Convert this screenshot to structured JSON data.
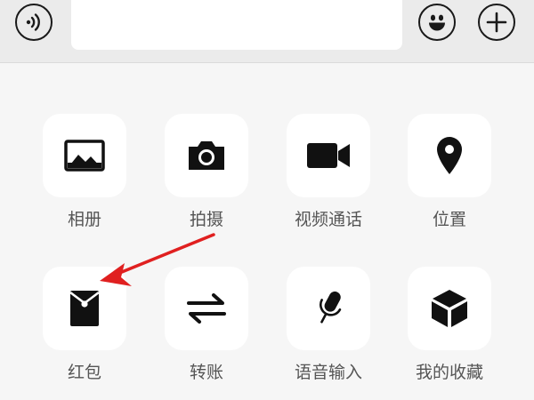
{
  "composer": {
    "voice_icon": "voice-wave-icon",
    "input_value": "",
    "emoji_icon": "smiley-icon",
    "more_icon": "plus-icon"
  },
  "panel": {
    "items": [
      {
        "label": "相册",
        "icon": "image-icon"
      },
      {
        "label": "拍摄",
        "icon": "camera-icon"
      },
      {
        "label": "视频通话",
        "icon": "video-camera-icon"
      },
      {
        "label": "位置",
        "icon": "location-pin-icon"
      },
      {
        "label": "红包",
        "icon": "red-packet-icon"
      },
      {
        "label": "转账",
        "icon": "transfer-arrows-icon"
      },
      {
        "label": "语音输入",
        "icon": "microphone-icon"
      },
      {
        "label": "我的收藏",
        "icon": "cube-icon"
      }
    ]
  },
  "annotation": {
    "arrow_color": "#e02020",
    "arrow_icon": "red-arrow-annotation",
    "target": "红包"
  }
}
